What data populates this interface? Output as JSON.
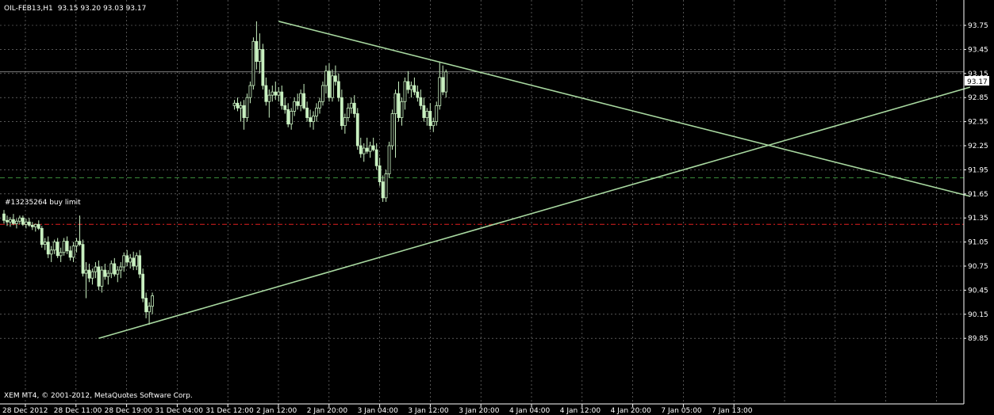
{
  "header": {
    "symbol_label": "OIL-FEB13,H1",
    "ohlc_label": "93.15 93.20 93.03 93.17"
  },
  "order_label": "#13235264 buy limit",
  "copyright": "XEM MT4, © 2001-2012, MetaQuotes Software Corp.",
  "current_price_label": "93.17",
  "colors": {
    "background": "#000000",
    "grid": "#8a8a8a",
    "candle": "#c8f0c0",
    "trendline": "#a8d8a0",
    "order_line": "#3a8a3a",
    "stop_line": "#e02020",
    "text": "#ffffff",
    "price_tag_bg": "#ffffff",
    "price_tag_text": "#000000"
  },
  "chart_data": {
    "type": "candlestick",
    "y_axis_ticks": [
      "93.75",
      "93.45",
      "93.15",
      "92.85",
      "92.55",
      "92.25",
      "91.95",
      "91.65",
      "91.35",
      "91.05",
      "90.75",
      "90.45",
      "90.15",
      "89.85"
    ],
    "ylim": [
      89.75,
      93.95
    ],
    "x_axis_labels": [
      "28 Dec 2012",
      "28 Dec 11:00",
      "28 Dec 19:00",
      "31 Dec 04:00",
      "31 Dec 12:00",
      "2 Jan 12:00",
      "2 Jan 20:00",
      "3 Jan 04:00",
      "3 Jan 12:00",
      "3 Jan 20:00",
      "4 Jan 04:00",
      "4 Jan 12:00",
      "4 Jan 20:00",
      "7 Jan 05:00",
      "7 Jan 13:00"
    ],
    "current_price": 93.17,
    "buy_limit_level": 91.85,
    "red_level": 91.27,
    "grid": true,
    "trendlines": [
      {
        "name": "descending",
        "from_bar": 87,
        "from_price": 93.8,
        "to_bar": 306,
        "to_price": 91.62
      },
      {
        "name": "ascending",
        "from_bar": 30,
        "from_price": 89.85,
        "to_bar": 306,
        "to_price": 92.98
      }
    ],
    "candles": [
      [
        91.4,
        91.45,
        91.28,
        91.32
      ],
      [
        91.32,
        91.38,
        91.25,
        91.3
      ],
      [
        91.3,
        91.36,
        91.24,
        91.33
      ],
      [
        91.33,
        91.4,
        91.26,
        91.28
      ],
      [
        91.28,
        91.34,
        91.22,
        91.31
      ],
      [
        91.31,
        91.38,
        91.27,
        91.35
      ],
      [
        91.35,
        91.38,
        91.25,
        91.27
      ],
      [
        91.27,
        91.34,
        91.22,
        91.3
      ],
      [
        91.3,
        91.35,
        91.24,
        91.26
      ],
      [
        91.26,
        91.3,
        91.2,
        91.24
      ],
      [
        91.24,
        91.28,
        91.18,
        91.27
      ],
      [
        91.27,
        91.32,
        91.2,
        91.22
      ],
      [
        91.22,
        91.25,
        90.98,
        91.02
      ],
      [
        91.02,
        91.1,
        90.95,
        91.05
      ],
      [
        91.05,
        91.12,
        90.85,
        90.9
      ],
      [
        90.9,
        91.0,
        90.8,
        90.95
      ],
      [
        90.95,
        91.08,
        90.9,
        91.05
      ],
      [
        91.05,
        91.1,
        90.85,
        90.88
      ],
      [
        90.88,
        90.98,
        90.8,
        90.92
      ],
      [
        90.92,
        91.1,
        90.88,
        91.06
      ],
      [
        91.06,
        91.12,
        90.9,
        90.94
      ],
      [
        90.94,
        91.0,
        90.82,
        90.86
      ],
      [
        90.86,
        91.05,
        90.8,
        91.0
      ],
      [
        91.0,
        91.1,
        90.92,
        91.06
      ],
      [
        91.06,
        91.38,
        91.0,
        91.02
      ],
      [
        91.02,
        91.08,
        90.62,
        90.66
      ],
      [
        90.66,
        90.8,
        90.35,
        90.7
      ],
      [
        90.7,
        90.78,
        90.55,
        90.6
      ],
      [
        90.6,
        90.72,
        90.52,
        90.68
      ],
      [
        90.68,
        90.8,
        90.6,
        90.74
      ],
      [
        90.74,
        90.82,
        90.45,
        90.5
      ],
      [
        90.5,
        90.75,
        90.42,
        90.7
      ],
      [
        90.7,
        90.78,
        90.58,
        90.62
      ],
      [
        90.62,
        90.7,
        90.52,
        90.66
      ],
      [
        90.66,
        90.82,
        90.6,
        90.78
      ],
      [
        90.78,
        90.85,
        90.62,
        90.65
      ],
      [
        90.65,
        90.75,
        90.55,
        90.7
      ],
      [
        90.7,
        90.8,
        90.6,
        90.74
      ],
      [
        90.74,
        90.92,
        90.68,
        90.88
      ],
      [
        90.88,
        90.95,
        90.75,
        90.8
      ],
      [
        90.8,
        90.9,
        90.72,
        90.85
      ],
      [
        90.85,
        90.93,
        90.7,
        90.75
      ],
      [
        90.75,
        90.92,
        90.7,
        90.88
      ],
      [
        90.88,
        90.95,
        90.6,
        90.65
      ],
      [
        90.65,
        90.72,
        90.3,
        90.35
      ],
      [
        90.35,
        90.42,
        90.1,
        90.18
      ],
      [
        90.18,
        90.3,
        90.02,
        90.25
      ],
      [
        90.25,
        90.42,
        90.15,
        90.38
      ],
      [
        92.75,
        92.82,
        92.7,
        92.78
      ],
      [
        92.78,
        92.85,
        92.68,
        92.72
      ],
      [
        92.72,
        92.8,
        92.55,
        92.75
      ],
      [
        92.75,
        92.82,
        92.45,
        92.6
      ],
      [
        92.6,
        92.9,
        92.55,
        92.85
      ],
      [
        92.85,
        93.05,
        92.78,
        93.0
      ],
      [
        93.0,
        93.6,
        92.95,
        93.55
      ],
      [
        93.55,
        93.8,
        93.2,
        93.3
      ],
      [
        93.3,
        93.65,
        93.15,
        93.45
      ],
      [
        93.45,
        93.52,
        92.95,
        93.0
      ],
      [
        93.0,
        93.1,
        92.75,
        92.8
      ],
      [
        92.8,
        92.95,
        92.6,
        92.88
      ],
      [
        92.88,
        93.0,
        92.8,
        92.92
      ],
      [
        92.92,
        93.05,
        92.82,
        92.88
      ],
      [
        92.88,
        92.98,
        92.8,
        92.92
      ],
      [
        92.92,
        93.0,
        92.7,
        92.75
      ],
      [
        92.75,
        92.85,
        92.65,
        92.7
      ],
      [
        92.7,
        92.78,
        92.48,
        92.52
      ],
      [
        92.52,
        92.72,
        92.45,
        92.68
      ],
      [
        92.68,
        92.85,
        92.62,
        92.8
      ],
      [
        92.8,
        92.9,
        92.7,
        92.75
      ],
      [
        92.75,
        92.95,
        92.68,
        92.9
      ],
      [
        92.9,
        93.02,
        92.7,
        92.72
      ],
      [
        92.72,
        92.8,
        92.55,
        92.6
      ],
      [
        92.6,
        92.7,
        92.48,
        92.55
      ],
      [
        92.55,
        92.68,
        92.45,
        92.62
      ],
      [
        92.62,
        92.78,
        92.55,
        92.72
      ],
      [
        92.72,
        92.85,
        92.65,
        92.8
      ],
      [
        92.8,
        93.05,
        92.75,
        93.0
      ],
      [
        93.0,
        93.25,
        92.9,
        93.18
      ],
      [
        93.18,
        93.28,
        92.8,
        92.85
      ],
      [
        92.85,
        93.2,
        92.8,
        93.12
      ],
      [
        93.12,
        93.25,
        93.0,
        93.05
      ],
      [
        93.05,
        93.15,
        92.8,
        92.85
      ],
      [
        92.85,
        92.95,
        92.45,
        92.5
      ],
      [
        92.5,
        92.65,
        92.4,
        92.6
      ],
      [
        92.6,
        92.78,
        92.55,
        92.72
      ],
      [
        92.72,
        92.85,
        92.65,
        92.78
      ],
      [
        92.78,
        92.88,
        92.6,
        92.65
      ],
      [
        92.65,
        92.72,
        92.2,
        92.25
      ],
      [
        92.25,
        92.35,
        92.1,
        92.15
      ],
      [
        92.15,
        92.28,
        92.05,
        92.22
      ],
      [
        92.22,
        92.35,
        92.15,
        92.18
      ],
      [
        92.18,
        92.3,
        92.1,
        92.25
      ],
      [
        92.25,
        92.35,
        92.18,
        92.2
      ],
      [
        92.2,
        92.28,
        91.95,
        92.0
      ],
      [
        92.0,
        92.1,
        91.75,
        91.8
      ],
      [
        91.8,
        91.88,
        91.55,
        91.6
      ],
      [
        91.6,
        91.95,
        91.55,
        91.9
      ],
      [
        91.9,
        92.3,
        91.85,
        92.25
      ],
      [
        92.25,
        92.7,
        92.2,
        92.65
      ],
      [
        92.65,
        92.95,
        92.1,
        92.9
      ],
      [
        92.9,
        93.05,
        92.55,
        92.6
      ],
      [
        92.6,
        92.85,
        92.5,
        92.8
      ],
      [
        92.8,
        93.1,
        92.7,
        93.05
      ],
      [
        93.05,
        93.18,
        92.9,
        92.95
      ],
      [
        92.95,
        93.05,
        92.85,
        93.0
      ],
      [
        93.0,
        93.1,
        92.88,
        92.92
      ],
      [
        92.92,
        93.0,
        92.8,
        92.85
      ],
      [
        92.85,
        92.95,
        92.7,
        92.75
      ],
      [
        92.75,
        92.85,
        92.55,
        92.6
      ],
      [
        92.6,
        92.72,
        92.5,
        92.68
      ],
      [
        92.68,
        92.78,
        92.45,
        92.5
      ],
      [
        92.5,
        92.6,
        92.42,
        92.55
      ],
      [
        92.55,
        92.8,
        92.5,
        92.75
      ],
      [
        92.75,
        93.3,
        92.7,
        93.1
      ],
      [
        93.1,
        93.25,
        92.88,
        92.92
      ],
      [
        92.92,
        93.2,
        92.85,
        93.17
      ]
    ]
  }
}
